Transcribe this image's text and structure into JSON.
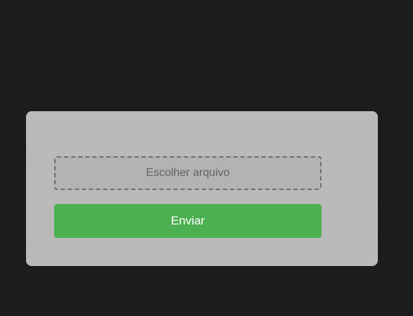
{
  "upload_form": {
    "file_picker_label": "Escolher arquivo",
    "submit_label": "Enviar"
  },
  "colors": {
    "page_background": "#1c1c1c",
    "card_background": "#bababa",
    "submit_background": "#4caf50",
    "submit_text": "#ffffff",
    "file_picker_border": "#6e6e6e",
    "file_picker_text": "#636363"
  }
}
